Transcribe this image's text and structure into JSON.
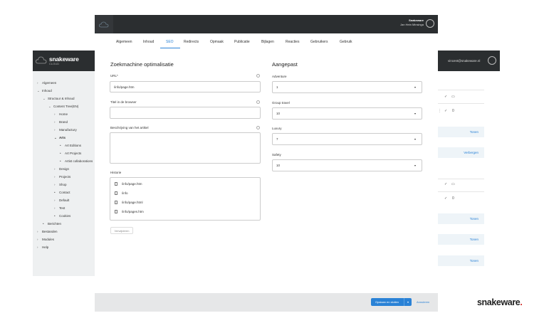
{
  "topbar": {
    "user_name": "Snakeware",
    "user_sub": "Jan Hein Minsinga"
  },
  "tabs": [
    "Algemeen",
    "Inhoud",
    "SEO",
    "Redirects",
    "Opmaak",
    "Publicatie",
    "Bijlagen",
    "Reacties",
    "Gebruikers",
    "Gebruik"
  ],
  "active_tab": "SEO",
  "sidebar": {
    "brand": "snakeware",
    "brand_sub": "CLOUD",
    "items": [
      "Algemeen",
      "Inhoud",
      "Structuur & Inhoud",
      "Content Tree(EN)",
      "Home",
      "Brand",
      "Manufactury",
      "Arts",
      "Art Editions",
      "Art Projects",
      "Artist collaborations",
      "Design",
      "Projects",
      "Shop",
      "Contact",
      "Default",
      "Test",
      "Cookies",
      "Berichten",
      "Bestanden",
      "Modules",
      "Help"
    ]
  },
  "seo": {
    "heading": "Zoekmachine optimalisatie",
    "url_label": "URL*",
    "url_value": "/info/page.htm",
    "title_label": "Titel in de browser",
    "title_value": "",
    "desc_label": "Beschrijving van het artikel",
    "desc_value": "",
    "history_label": "Historie",
    "history": [
      "/info/page.htm",
      "/info",
      "/info/page.html",
      "/info/pages.htm"
    ],
    "delete_button": "Verwijderen"
  },
  "custom": {
    "heading": "Aangepast",
    "fields": [
      {
        "label": "Adventure",
        "value": "1"
      },
      {
        "label": "Group travel",
        "value": "10"
      },
      {
        "label": "Luxury",
        "value": "7"
      },
      {
        "label": "Safety",
        "value": "10"
      }
    ]
  },
  "rightpanel": {
    "email": "vincent@snakeware.nl",
    "count_a": "0",
    "count_b": "0",
    "btn_tonen": "Tonen",
    "btn_verbergen": "Verbergen"
  },
  "footer": {
    "save_label": "Opslaan en sluiten",
    "cancel_label": "Annuleren"
  },
  "footer_brand": "snakeware",
  "colors": {
    "accent": "#2a82d6",
    "dark": "#2b2e30",
    "sidebar_bg": "#eef0f1",
    "brand_dot": "#d0312d"
  }
}
